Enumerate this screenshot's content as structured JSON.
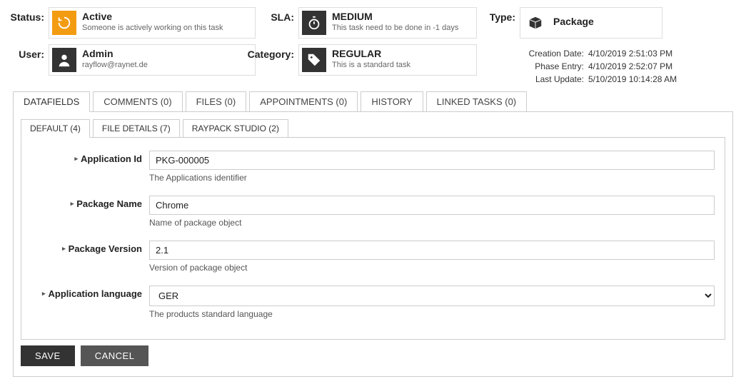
{
  "header": {
    "status": {
      "label": "Status:",
      "title": "Active",
      "sub": "Someone is actively working on this task"
    },
    "sla": {
      "label": "SLA:",
      "title": "MEDIUM",
      "sub": "This task need to be done in -1 days"
    },
    "type": {
      "label": "Type:",
      "title": "Package"
    },
    "user": {
      "label": "User:",
      "title": "Admin",
      "sub": "rayflow@raynet.de"
    },
    "category": {
      "label": "Category:",
      "title": "REGULAR",
      "sub": "This is a standard task"
    },
    "meta": {
      "creation": {
        "k": "Creation Date:",
        "v": "4/10/2019 2:51:03 PM"
      },
      "phase": {
        "k": "Phase Entry:",
        "v": "4/10/2019 2:52:07 PM"
      },
      "update": {
        "k": "Last Update:",
        "v": "5/10/2019 10:14:28 AM"
      }
    }
  },
  "main_tabs": {
    "datafields": "DATAFIELDS",
    "comments": "COMMENTS (0)",
    "files": "FILES (0)",
    "appointments": "APPOINTMENTS (0)",
    "history": "HISTORY",
    "linked": "LINKED TASKS (0)"
  },
  "sub_tabs": {
    "default": "DEFAULT (4)",
    "file_details": "FILE DETAILS (7)",
    "raypack": "RAYPACK STUDIO (2)"
  },
  "fields": {
    "app_id": {
      "label": "Application Id",
      "value": "PKG-000005",
      "help": "The Applications identifier"
    },
    "pkg_name": {
      "label": "Package Name",
      "value": "Chrome",
      "help": "Name of package object"
    },
    "pkg_ver": {
      "label": "Package Version",
      "value": "2.1",
      "help": "Version of package object"
    },
    "app_lang": {
      "label": "Application language",
      "value": "GER",
      "help": "The products standard language"
    }
  },
  "buttons": {
    "save": "SAVE",
    "cancel": "CANCEL"
  }
}
